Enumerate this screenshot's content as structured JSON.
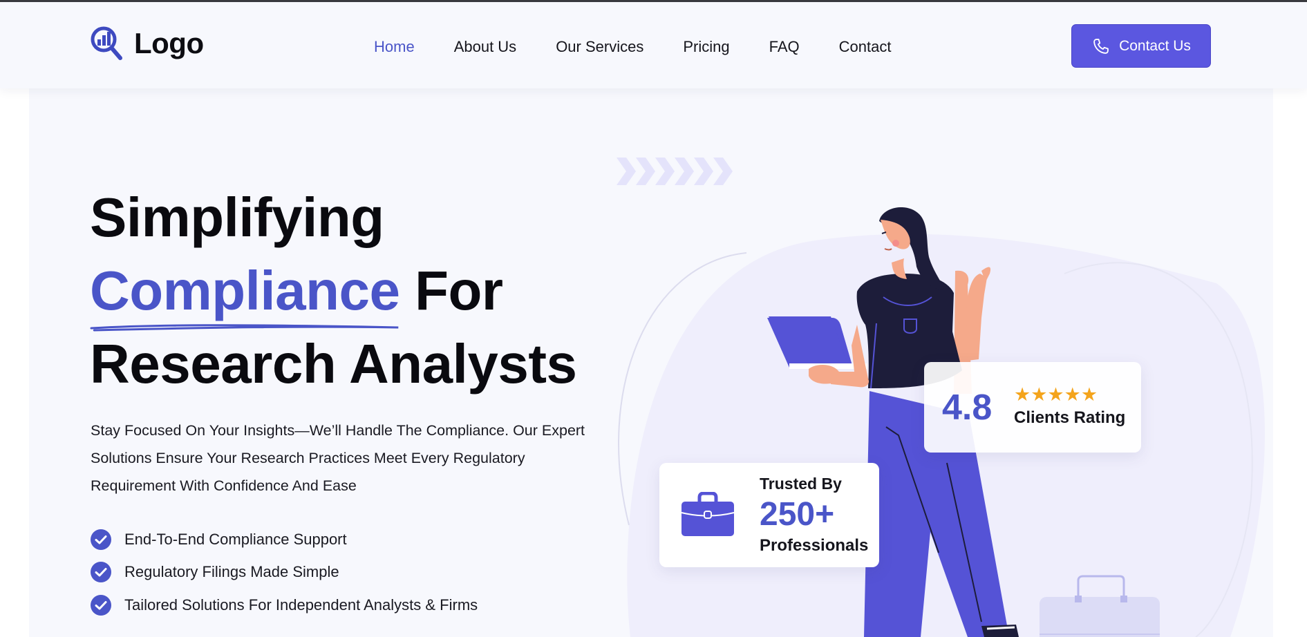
{
  "header": {
    "logo_text": "Logo",
    "nav": [
      "Home",
      "About Us",
      "Our Services",
      "Pricing",
      "FAQ",
      "Contact"
    ],
    "active_nav": "Home",
    "cta_label": "Contact Us"
  },
  "hero": {
    "headline_line1": "Simplifying",
    "headline_highlight": "Compliance",
    "headline_line2_rest": " For",
    "headline_line3": "Research Analysts",
    "description": "Stay Focused On Your Insights—We’ll Handle The Compliance. Our Expert Solutions Ensure Your Research Practices Meet Every Regulatory Requirement With Confidence And Ease",
    "features": [
      "End-To-End Compliance Support",
      "Regulatory Filings Made Simple",
      "Tailored Solutions For Independent Analysts & Firms"
    ]
  },
  "rating_card": {
    "value": "4.8",
    "stars": 5,
    "star_glyphs": "★★★★★",
    "label": "Clients Rating"
  },
  "trust_card": {
    "top": "Trusted By",
    "number": "250+",
    "bottom": "Professionals"
  },
  "colors": {
    "accent": "#4a55c8",
    "button": "#5b57e0",
    "star": "#f4a41c",
    "hero_bg": "#f7f8fd"
  },
  "icons": {
    "logo": "magnifier-bar-chart-icon",
    "cta": "phone-icon",
    "feature": "check-circle-icon",
    "trust": "briefcase-icon"
  }
}
